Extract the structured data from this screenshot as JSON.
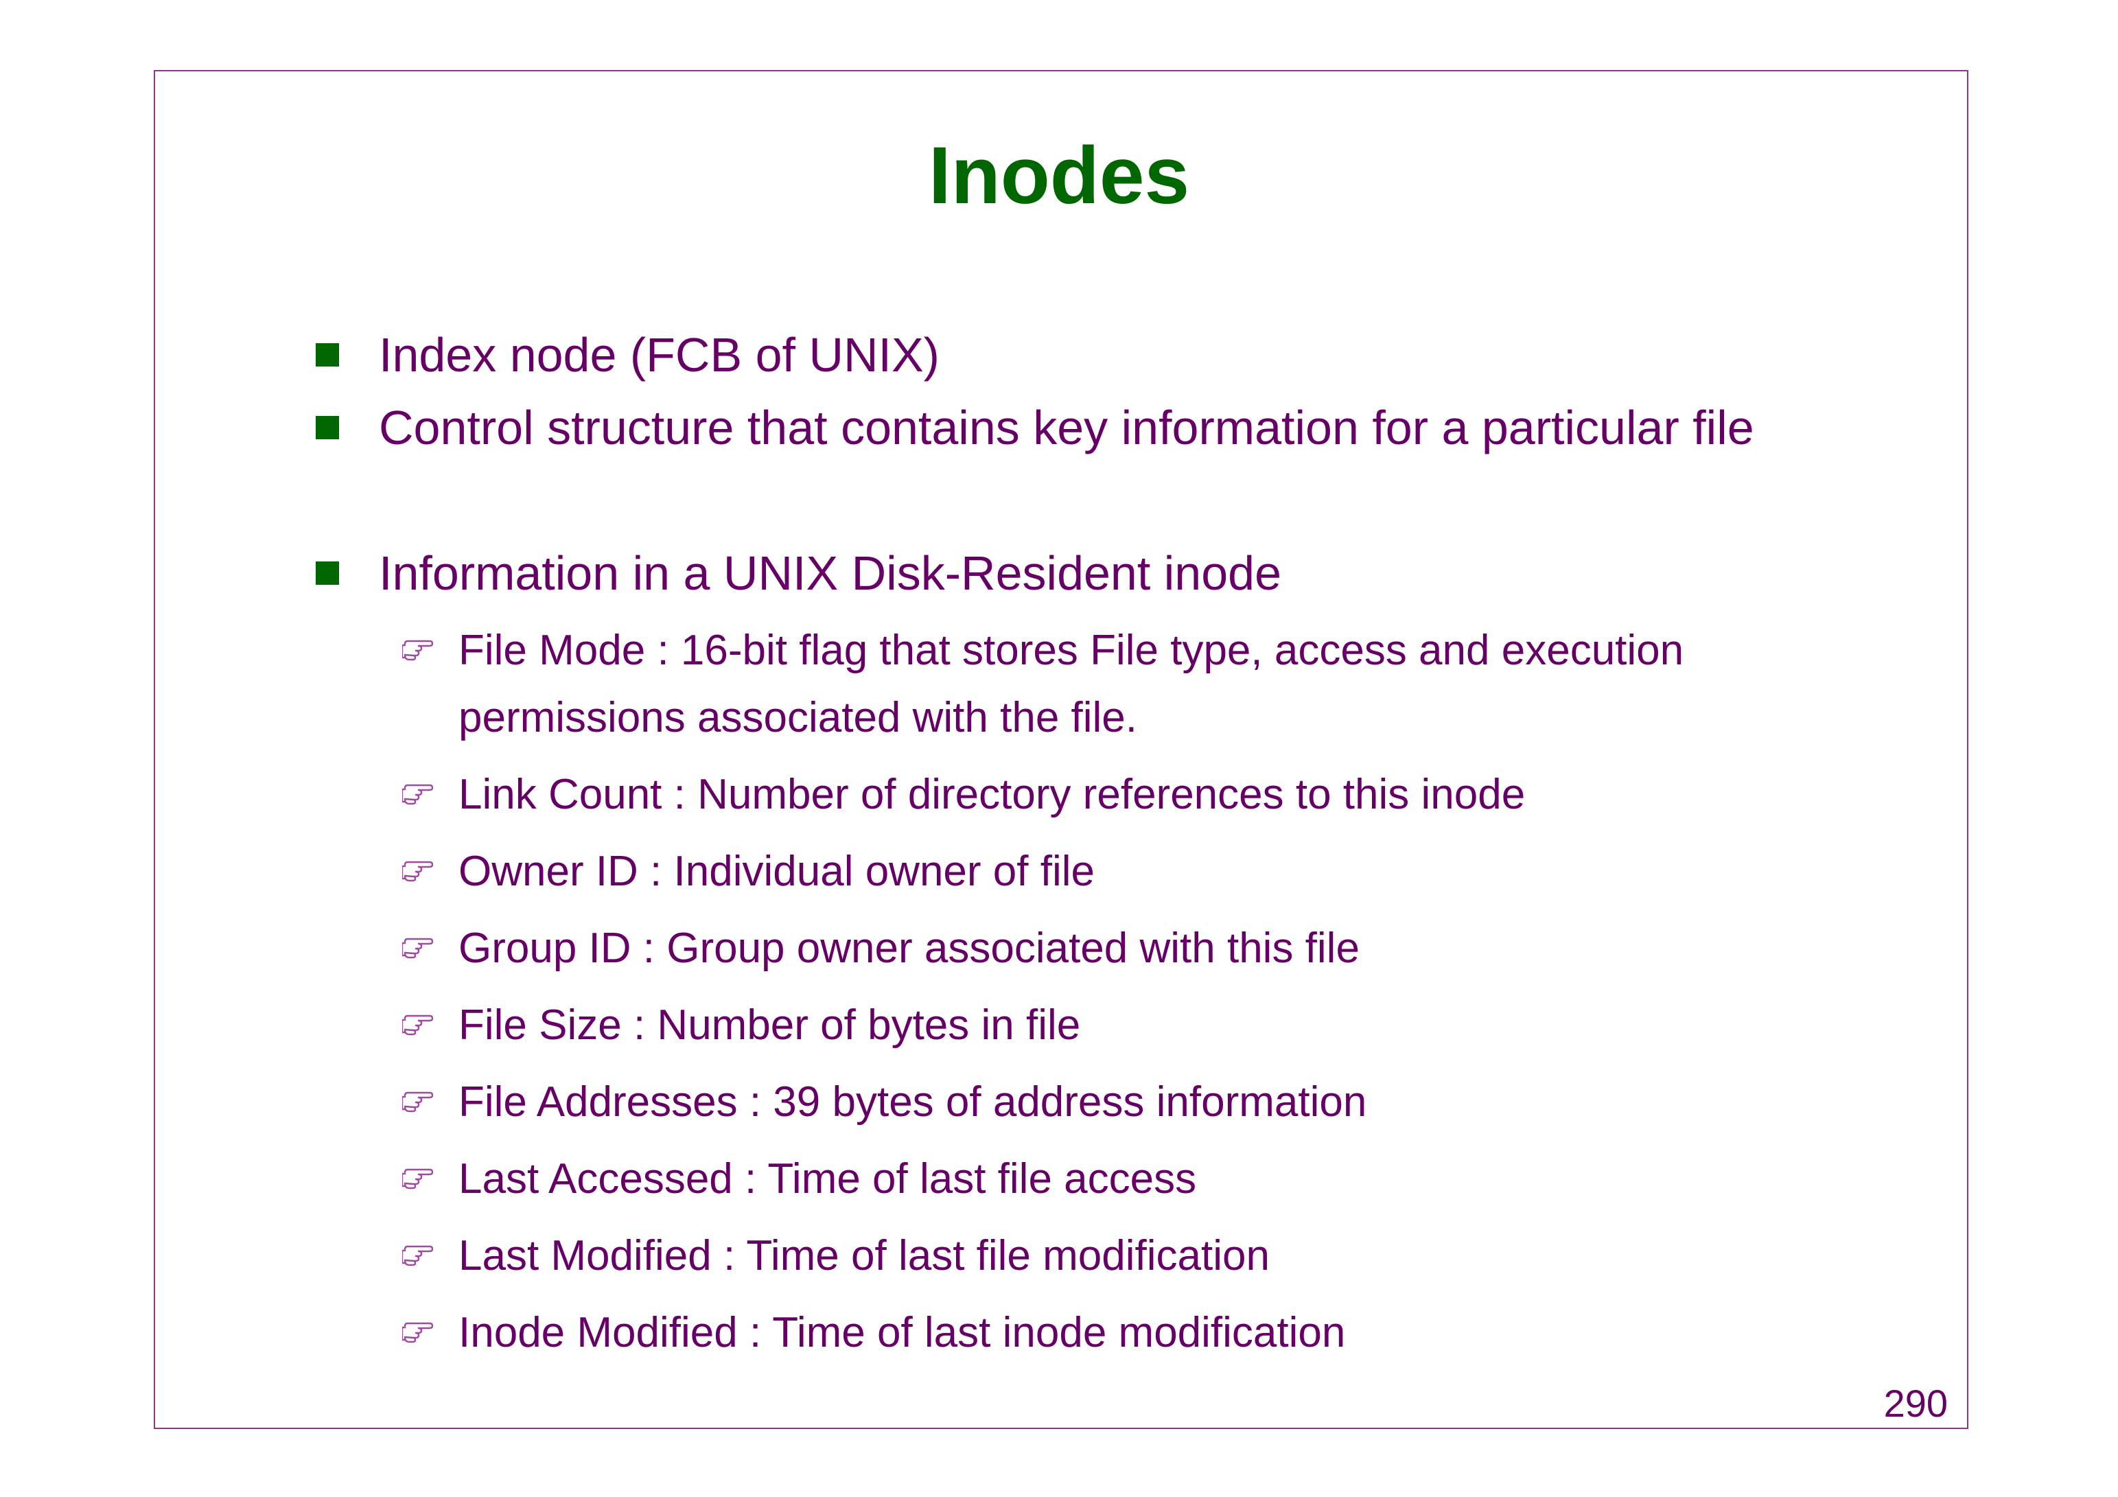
{
  "slide": {
    "title": "Inodes",
    "page_number": "290",
    "colors": {
      "title": "#006600",
      "text": "#660066",
      "bullet": "#006600",
      "frame": "#8b3a8b"
    },
    "bullets": [
      "Index node (FCB of UNIX)",
      "Control structure that contains key information for a particular file",
      "Information in a UNIX Disk-Resident inode"
    ],
    "sub_bullet_icon": "pointing-hand-icon",
    "sub_bullets": {
      "file_mode_line1": "File Mode : 16-bit flag that stores File type, access and execution",
      "file_mode_line2": "permissions associated with the file.",
      "link_count": "Link Count : Number of directory references to this inode",
      "owner_id": "Owner ID : Individual owner of file",
      "group_id": "Group ID : Group owner associated with this file",
      "file_size": "File Size : Number of bytes in file",
      "file_addresses": "File Addresses : 39 bytes of address information",
      "last_accessed": "Last Accessed : Time of last file access",
      "last_modified": "Last Modified : Time of last file modification",
      "inode_modified": "Inode Modified : Time of last inode modification"
    }
  }
}
